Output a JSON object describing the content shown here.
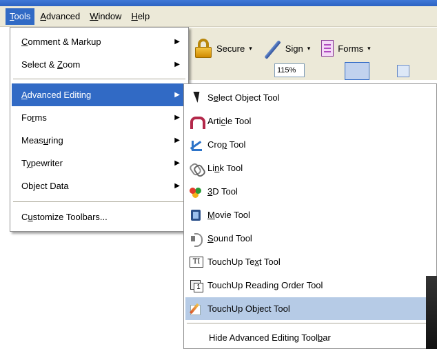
{
  "menubar": [
    {
      "pre": "",
      "u": "T",
      "post": "ools",
      "active": true
    },
    {
      "pre": "",
      "u": "A",
      "post": "dvanced",
      "active": false
    },
    {
      "pre": "",
      "u": "W",
      "post": "indow",
      "active": false
    },
    {
      "pre": "",
      "u": "H",
      "post": "elp",
      "active": false
    }
  ],
  "toolbar": {
    "secure_label": "Secure",
    "sign_label": "Sign",
    "forms_label": "Forms",
    "caret": "▾",
    "zoom_value": "115%"
  },
  "tools_menu": {
    "items": [
      {
        "pre": "",
        "u": "C",
        "post": "omment & Markup",
        "arrow": "▶"
      },
      {
        "pre": "Select & ",
        "u": "Z",
        "post": "oom",
        "arrow": "▶"
      },
      {
        "pre": "",
        "u": "A",
        "post": "dvanced Editing",
        "arrow": "▶"
      },
      {
        "pre": "Fo",
        "u": "r",
        "post": "ms",
        "arrow": "▶"
      },
      {
        "pre": "Meas",
        "u": "u",
        "post": "ring",
        "arrow": "▶"
      },
      {
        "pre": "T",
        "u": "y",
        "post": "pewriter",
        "arrow": "▶"
      },
      {
        "pre": "Ob",
        "u": "j",
        "post": "ect Data",
        "arrow": "▶"
      },
      {
        "pre": "C",
        "u": "u",
        "post": "stomize Toolbars...",
        "arrow": ""
      }
    ],
    "selected_index": 2
  },
  "advanced_editing_menu": {
    "items": [
      {
        "icon": "select-object-arrow-icon",
        "pre": "S",
        "u": "e",
        "post": "lect Object Tool"
      },
      {
        "icon": "article-icon",
        "pre": "Arti",
        "u": "c",
        "post": "le Tool"
      },
      {
        "icon": "crop-icon",
        "pre": "Cro",
        "u": "p",
        "post": " Tool"
      },
      {
        "icon": "link-icon",
        "pre": "Li",
        "u": "n",
        "post": "k Tool"
      },
      {
        "icon": "3d-icon",
        "pre": "",
        "u": "3",
        "post": "D Tool"
      },
      {
        "icon": "movie-icon",
        "pre": "",
        "u": "M",
        "post": "ovie Tool"
      },
      {
        "icon": "sound-icon",
        "pre": "",
        "u": "S",
        "post": "ound Tool"
      },
      {
        "icon": "touchup-text-icon",
        "pre": "TouchUp Te",
        "u": "x",
        "post": "t Tool"
      },
      {
        "icon": "touchup-reading-order-icon",
        "pre": "TouchUp Readin",
        "u": "g",
        "post": " Order Tool"
      },
      {
        "icon": "touchup-object-icon",
        "pre": "TouchUp Obje",
        "u": "",
        "post": "ct Tool"
      },
      {
        "icon": "",
        "pre": "Hide Advanced Editing Tool",
        "u": "b",
        "post": "ar"
      }
    ],
    "selected_index": 9,
    "touchup_text_glyph": "TI"
  }
}
